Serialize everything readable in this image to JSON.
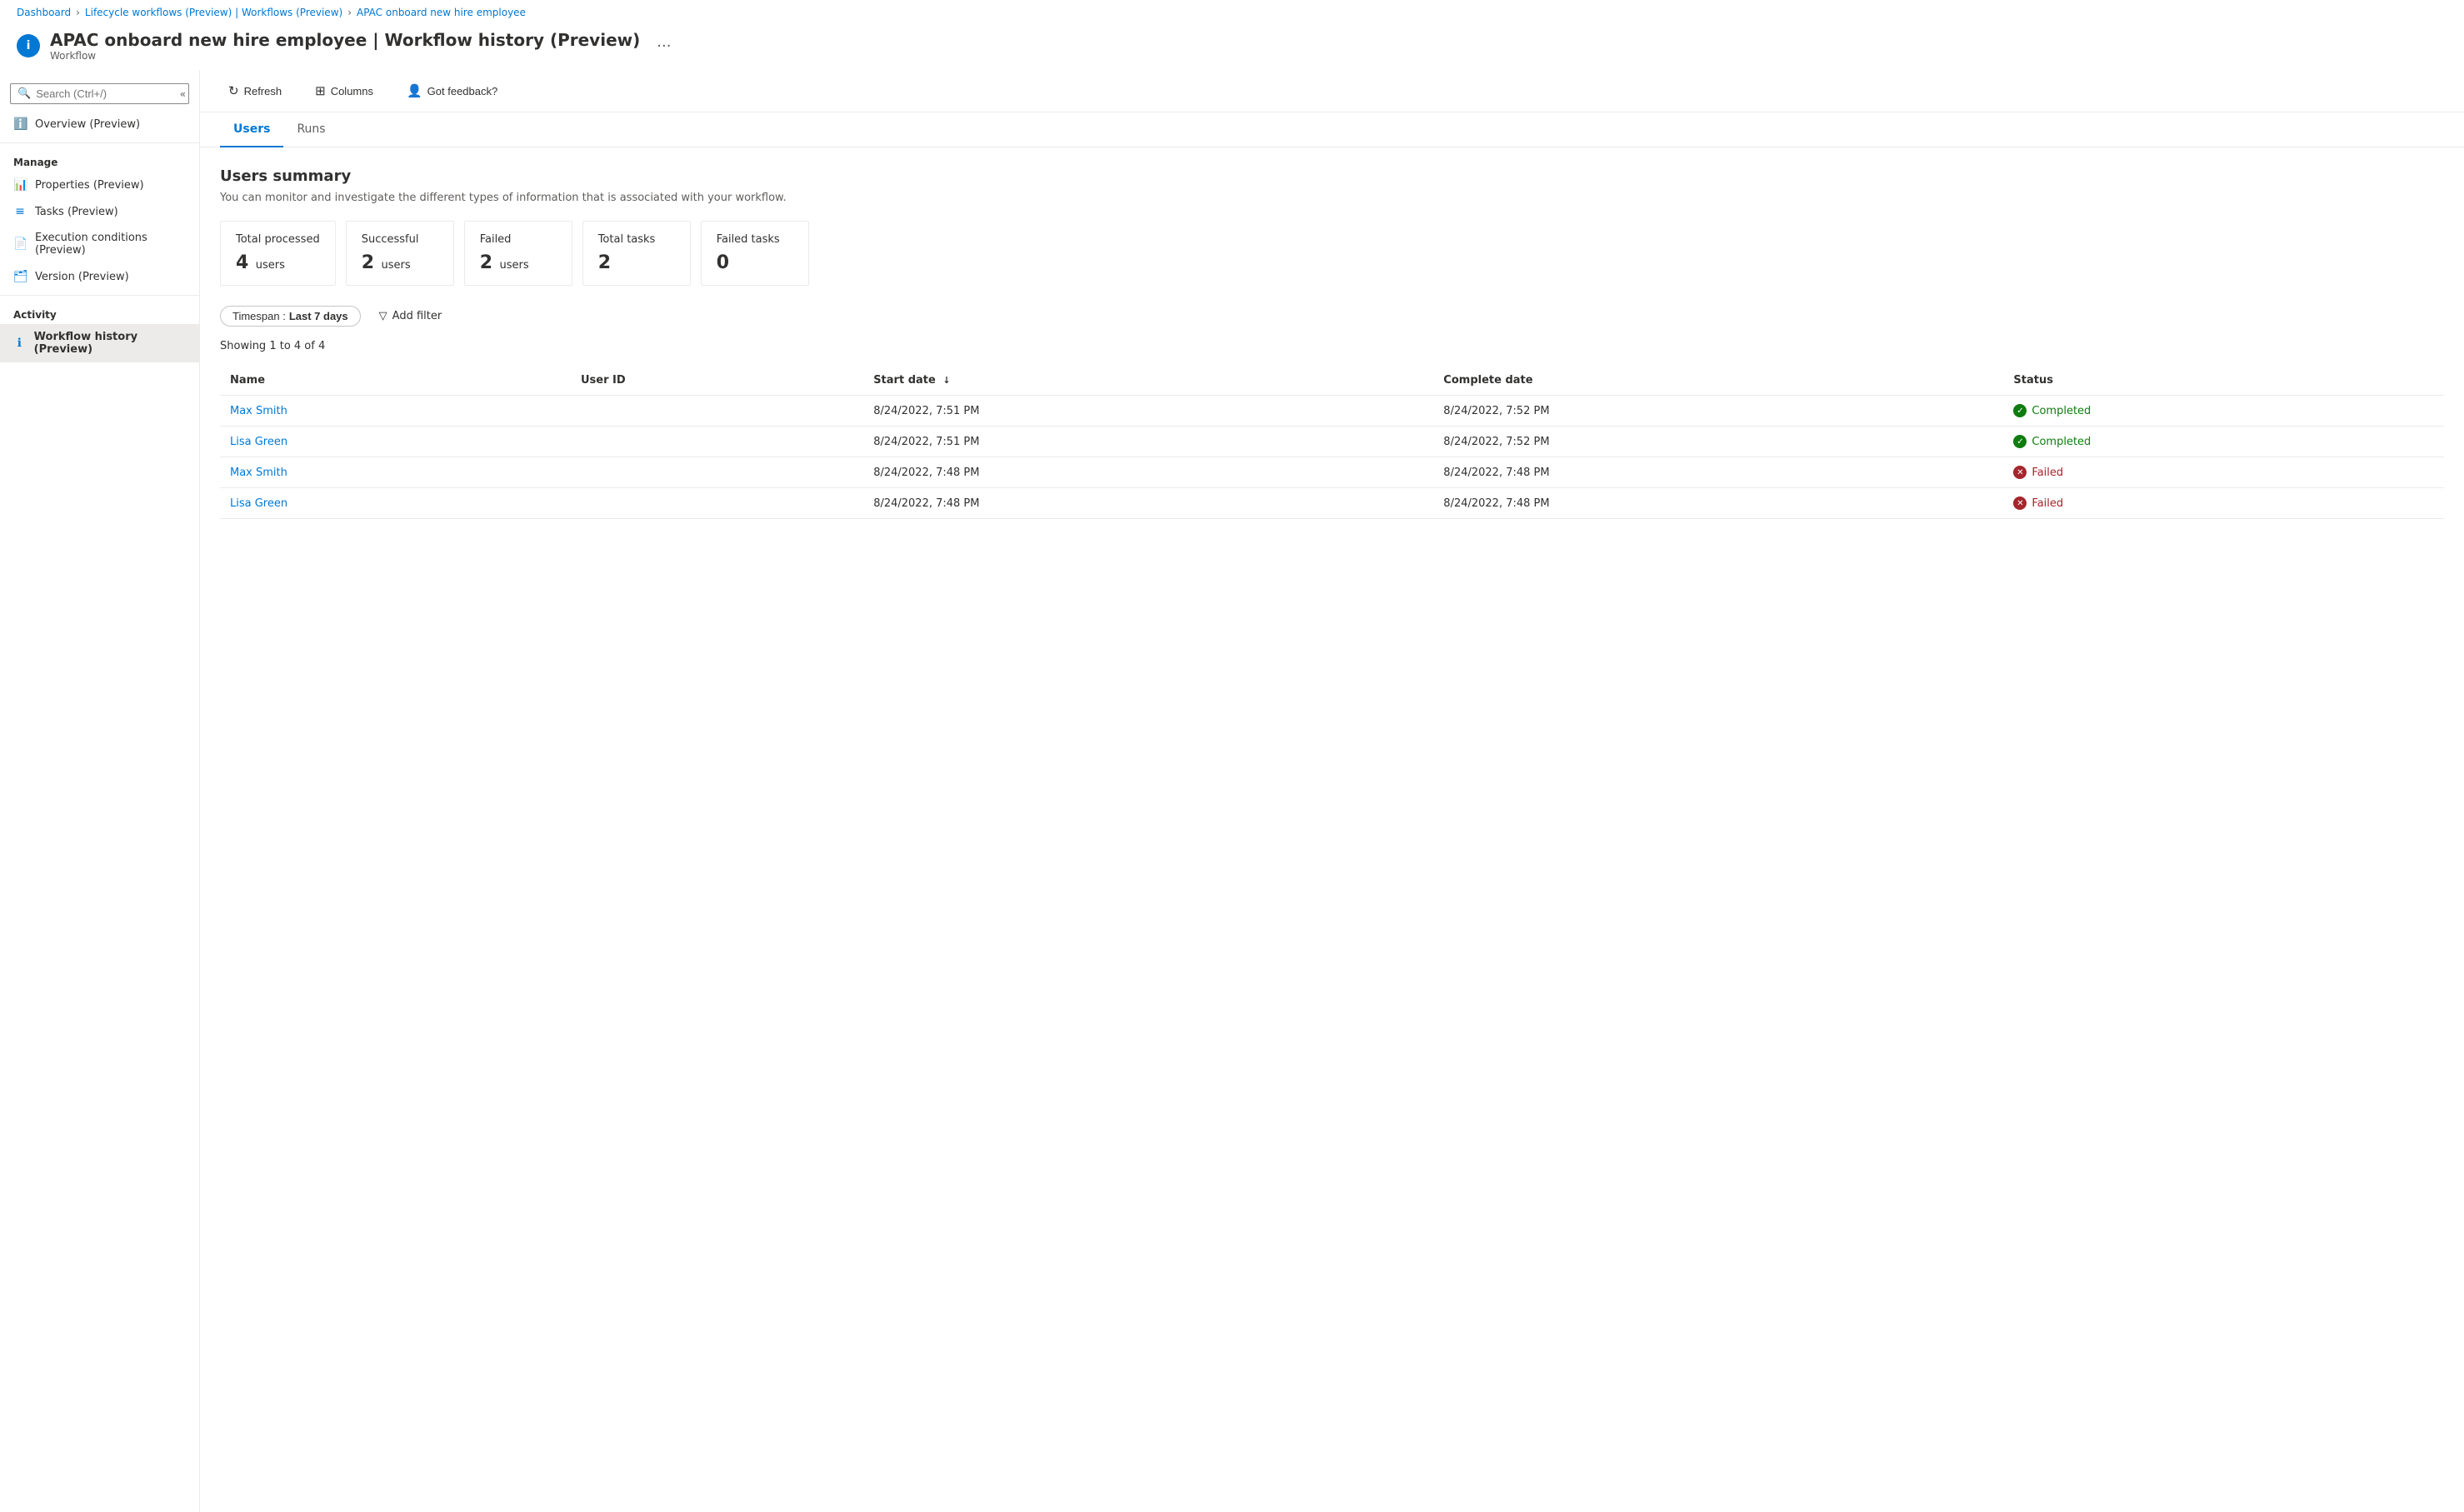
{
  "breadcrumb": {
    "items": [
      {
        "label": "Dashboard",
        "link": true
      },
      {
        "label": "Lifecycle workflows (Preview) | Workflows (Preview)",
        "link": true
      },
      {
        "label": "APAC onboard new hire employee",
        "link": true
      }
    ]
  },
  "header": {
    "title": "APAC onboard new hire employee | Workflow history (Preview)",
    "subtitle": "Workflow",
    "more_label": "···"
  },
  "toolbar": {
    "refresh_label": "Refresh",
    "columns_label": "Columns",
    "feedback_label": "Got feedback?"
  },
  "search": {
    "placeholder": "Search (Ctrl+/)"
  },
  "sidebar": {
    "overview_label": "Overview (Preview)",
    "manage_label": "Manage",
    "items_manage": [
      {
        "label": "Properties (Preview)",
        "icon": "bar-chart"
      },
      {
        "label": "Tasks (Preview)",
        "icon": "list"
      },
      {
        "label": "Execution conditions (Preview)",
        "icon": "page"
      },
      {
        "label": "Version (Preview)",
        "icon": "stack"
      }
    ],
    "activity_label": "Activity",
    "items_activity": [
      {
        "label": "Workflow history (Preview)",
        "icon": "info",
        "active": true
      }
    ]
  },
  "tabs": [
    {
      "label": "Users",
      "active": true
    },
    {
      "label": "Runs",
      "active": false
    }
  ],
  "summary": {
    "title": "Users summary",
    "description": "You can monitor and investigate the different types of information that is associated with your workflow.",
    "cards": [
      {
        "label": "Total processed",
        "value": "4",
        "unit": "users"
      },
      {
        "label": "Successful",
        "value": "2",
        "unit": "users"
      },
      {
        "label": "Failed",
        "value": "2",
        "unit": "users"
      },
      {
        "label": "Total tasks",
        "value": "2",
        "unit": ""
      },
      {
        "label": "Failed tasks",
        "value": "0",
        "unit": ""
      }
    ]
  },
  "filters": {
    "timespan_label": "Timespan :",
    "timespan_value": "Last 7 days",
    "add_filter_label": "Add filter"
  },
  "table": {
    "showing_text": "Showing 1 to 4 of 4",
    "columns": [
      {
        "label": "Name",
        "sortable": false
      },
      {
        "label": "User ID",
        "sortable": false
      },
      {
        "label": "Start date",
        "sortable": true
      },
      {
        "label": "Complete date",
        "sortable": false
      },
      {
        "label": "Status",
        "sortable": false
      }
    ],
    "rows": [
      {
        "name": "Max Smith",
        "user_id": "",
        "start_date": "8/24/2022, 7:51 PM",
        "complete_date": "8/24/2022, 7:52 PM",
        "status": "Completed"
      },
      {
        "name": "Lisa Green",
        "user_id": "",
        "start_date": "8/24/2022, 7:51 PM",
        "complete_date": "8/24/2022, 7:52 PM",
        "status": "Completed"
      },
      {
        "name": "Max Smith",
        "user_id": "",
        "start_date": "8/24/2022, 7:48 PM",
        "complete_date": "8/24/2022, 7:48 PM",
        "status": "Failed"
      },
      {
        "name": "Lisa Green",
        "user_id": "",
        "start_date": "8/24/2022, 7:48 PM",
        "complete_date": "8/24/2022, 7:48 PM",
        "status": "Failed"
      }
    ]
  }
}
